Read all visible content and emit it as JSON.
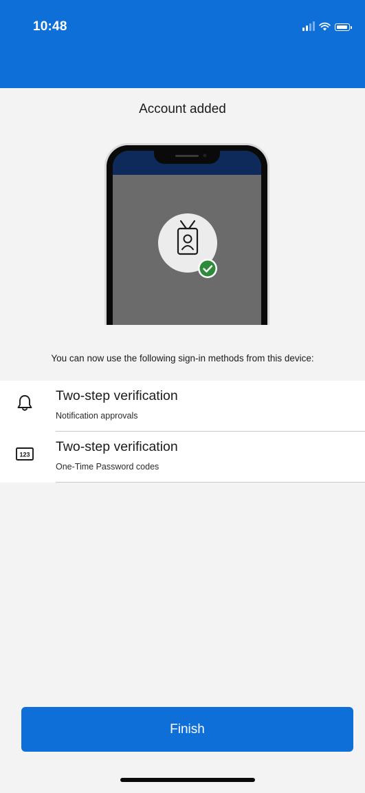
{
  "status_bar": {
    "time": "10:48",
    "icons": [
      "signal-icon",
      "wifi-icon",
      "battery-icon"
    ]
  },
  "page": {
    "title": "Account added",
    "description": "You can now use the following sign-in methods from this device:"
  },
  "methods": [
    {
      "icon": "bell-icon",
      "title": "Two-step verification",
      "subtitle": "Notification approvals"
    },
    {
      "icon": "otp-code-icon",
      "title": "Two-step verification",
      "subtitle": "One-Time Password codes"
    }
  ],
  "otp_icon_text": "123",
  "finish_button": {
    "label": "Finish"
  },
  "colors": {
    "brand_blue": "#0f6fd8",
    "background": "#f3f3f3",
    "success_green": "#2e8b3a"
  }
}
